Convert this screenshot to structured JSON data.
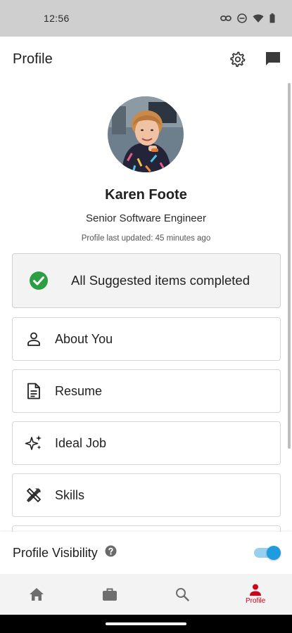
{
  "status_bar": {
    "time": "12:56"
  },
  "app_bar": {
    "title": "Profile"
  },
  "profile": {
    "name": "Karen Foote",
    "job_title": "Senior Software Engineer",
    "last_updated": "Profile last updated: 45 minutes ago"
  },
  "suggested": {
    "label": "All Suggested items completed"
  },
  "sections": [
    {
      "label": "About You",
      "icon": "person-icon"
    },
    {
      "label": "Resume",
      "icon": "document-icon"
    },
    {
      "label": "Ideal Job",
      "icon": "sparkle-icon"
    },
    {
      "label": "Skills",
      "icon": "tools-icon"
    }
  ],
  "visibility": {
    "label": "Profile Visibility",
    "enabled": true
  },
  "bottom_nav": {
    "active_label": "Profile"
  },
  "colors": {
    "accent_red": "#d0021b",
    "check_green": "#2e9e45",
    "toggle_blue": "#1f9be0"
  }
}
